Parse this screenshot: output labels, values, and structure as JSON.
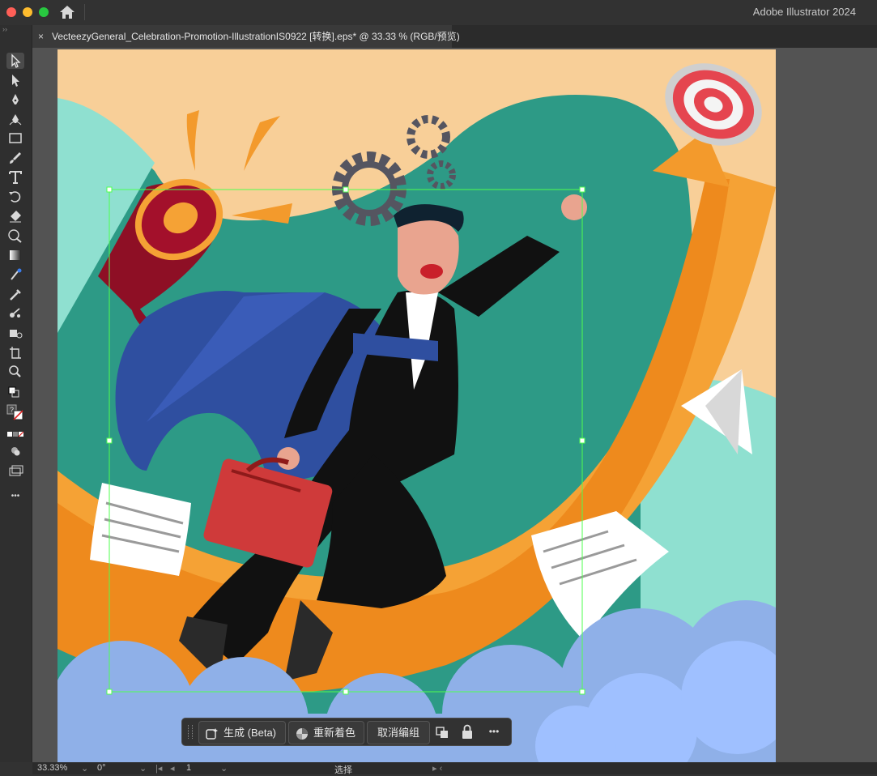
{
  "app": {
    "title": "Adobe Illustrator 2024"
  },
  "document_tab": {
    "close_glyph": "×",
    "name": "VecteezyGeneral_Celebration-Promotion-IllustrationIS0922 [转换].eps* @ 33.33 % (RGB/预览)"
  },
  "toolbar": {
    "items": [
      "selection-tool",
      "direct-selection-tool",
      "pen-tool",
      "curvature-tool",
      "rectangle-tool",
      "paintbrush-tool",
      "type-tool",
      "rotate-tool",
      "eraser-tool",
      "warp-tool",
      "gradient-tool",
      "shape-builder-tool",
      "eyedropper-tool",
      "puppet-warp-tool",
      "symbol-sprayer-tool",
      "artboard-tool",
      "zoom-tool"
    ],
    "more_glyph": "•••"
  },
  "context_bar": {
    "generate_label": "生成 (Beta)",
    "recolor_label": "重新着色",
    "ungroup_label": "取消编组",
    "more_glyph": "•••"
  },
  "status_bar": {
    "zoom": "33.33%",
    "rotation": "0°",
    "artboard_index": "1",
    "tool_name": "选择"
  },
  "colors": {
    "ui_bg": "#323232",
    "selection": "#4fff4f",
    "teal": "#2d9a86",
    "peach": "#f8cf98",
    "orange": "#f39a2c",
    "cloud": "#8fb0e8",
    "cape": "#2f4fa0",
    "suit": "#111111",
    "bag": "#cf3a3a",
    "megaphone": "#8e0f25",
    "gear": "#555560"
  }
}
